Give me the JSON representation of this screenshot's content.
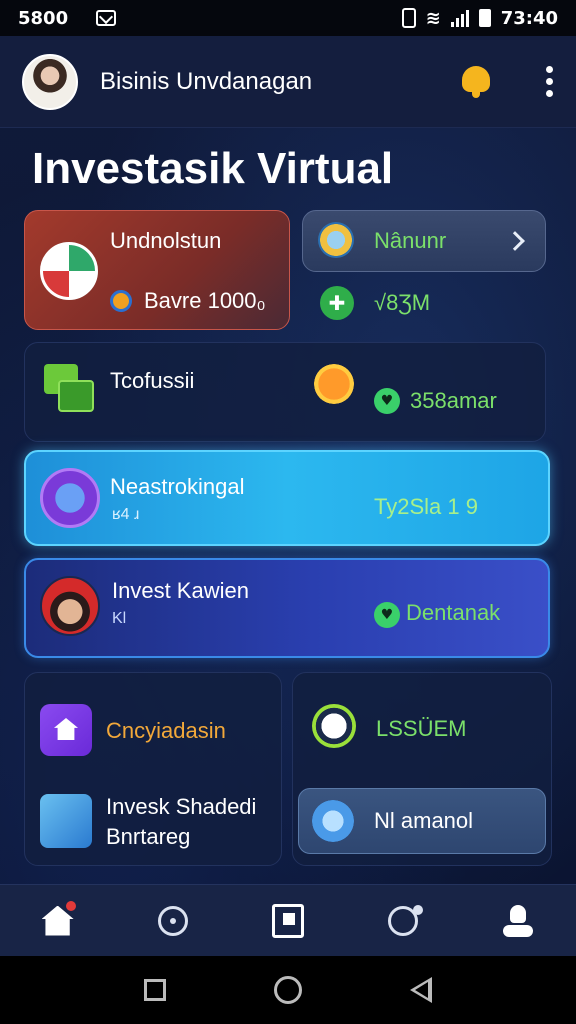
{
  "status_bar": {
    "time_left": "5800",
    "time_right": "73:40"
  },
  "header": {
    "title": "Bisinis Unvdanagan"
  },
  "page_title": "Investasik Virtual",
  "cards": {
    "card1": {
      "title": "Undnolstun",
      "subtitle": "Bavre 1000₀"
    },
    "card2": {
      "title": "Nânunr",
      "value": "√8ƷM"
    },
    "card3": {
      "title": "Tcofussii",
      "value": "358amar"
    },
    "card4": {
      "title": "Neastrokingal",
      "subtitle": "ʁ4 ɹ",
      "value": "Ty2Sla 1 9"
    },
    "card5": {
      "title": "Invest Kawien",
      "subtitle": "Kl",
      "value": "Dentanak"
    },
    "card6": {
      "item1": "Cncyiadasin",
      "item2_line1": "Invesk Shadedi",
      "item2_line2": "Bnrtareg"
    },
    "card7": {
      "value": "LSSÜEM",
      "button": "Nl amanol"
    }
  },
  "colors": {
    "accent_green": "#7be06a",
    "accent_yellow": "#f5b51e",
    "cyan_card": "#2cb8ef",
    "blue_card": "#2a3fb0"
  },
  "icons": {
    "bell": "bell-icon",
    "more": "more-vertical-icon",
    "home_nav": "home-icon",
    "explore_nav": "circle-icon",
    "flag_nav": "flag-icon",
    "search_nav": "search-person-icon",
    "profile_nav": "profile-icon"
  }
}
